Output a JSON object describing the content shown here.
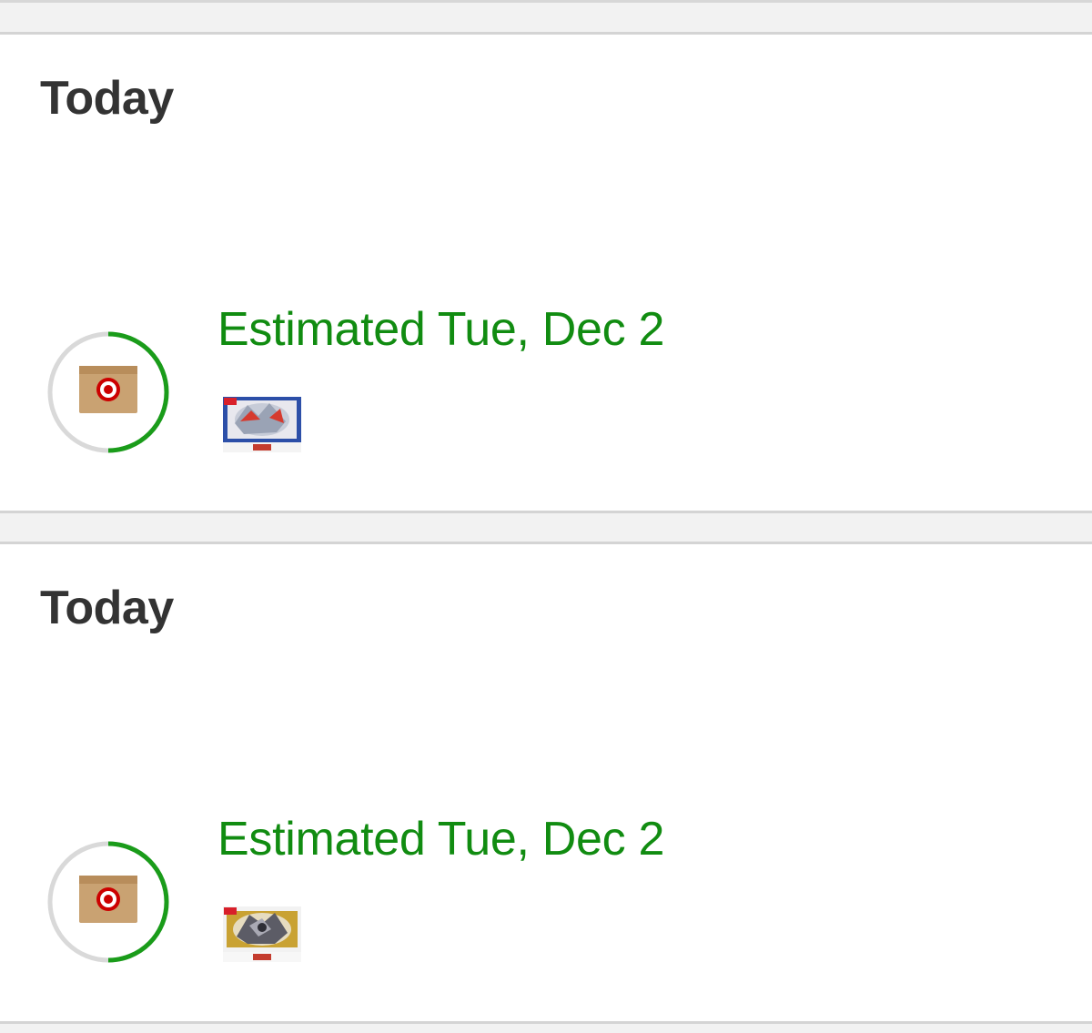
{
  "colors": {
    "accent_green": "#118c11",
    "heading": "#333333",
    "ring_track": "#d9d9d9",
    "ring_progress": "#1a9c1a",
    "target_red": "#cc0000",
    "box_brown": "#c9a272"
  },
  "orders": [
    {
      "day_heading": "Today",
      "status_icon": "target-package-icon",
      "delivery_progress": 0.5,
      "estimate_text": "Estimated Tue, Dec 2",
      "product_thumbnail": "product-box-thumbnail"
    },
    {
      "day_heading": "Today",
      "status_icon": "target-package-icon",
      "delivery_progress": 0.5,
      "estimate_text": "Estimated Tue, Dec 2",
      "product_thumbnail": "product-box-thumbnail"
    }
  ]
}
